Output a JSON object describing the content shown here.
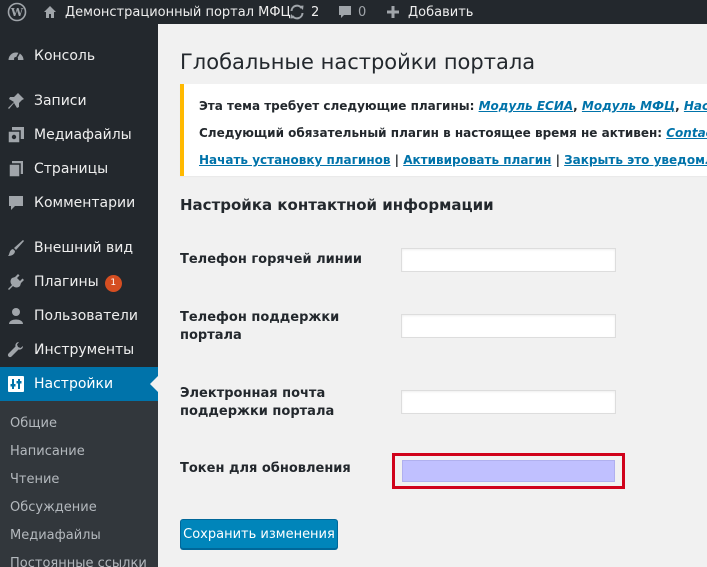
{
  "adminbar": {
    "site_title": "Демонстрационный портал МФЦ",
    "updates_count": "2",
    "comments_count": "0",
    "new_label": "Добавить"
  },
  "sidebar": {
    "items": [
      {
        "label": "Консоль",
        "icon": "dashboard-icon"
      },
      {
        "label": "Записи",
        "icon": "pin-icon"
      },
      {
        "label": "Медиафайлы",
        "icon": "media-icon"
      },
      {
        "label": "Страницы",
        "icon": "pages-icon"
      },
      {
        "label": "Комментарии",
        "icon": "comment-icon"
      },
      {
        "label": "Внешний вид",
        "icon": "brush-icon"
      },
      {
        "label": "Плагины",
        "icon": "plugin-icon",
        "badge": "1"
      },
      {
        "label": "Пользователи",
        "icon": "users-icon"
      },
      {
        "label": "Инструменты",
        "icon": "wrench-icon"
      },
      {
        "label": "Настройки",
        "icon": "settings-icon",
        "active": true
      }
    ],
    "submenu": [
      "Общие",
      "Написание",
      "Чтение",
      "Обсуждение",
      "Медиафайлы",
      "Постоянные ссылки"
    ]
  },
  "page": {
    "title": "Глобальные настройки портала"
  },
  "notice": {
    "line1_text": "Эта тема требует следующие плагины: ",
    "line1_links": [
      "Модуль ЕСИА",
      "Модуль МФЦ",
      "Настройка"
    ],
    "line1_sep": ", ",
    "line2_text": "Следующий обязательный плагин в настоящее время не активен: ",
    "line2_link": "Contact Form",
    "actions": [
      "Начать установку плагинов",
      "Активировать плагин",
      "Закрыть это уведомление"
    ],
    "actions_sep": " | "
  },
  "form": {
    "section_title": "Настройка контактной информации",
    "fields": [
      {
        "label": "Телефон горячей линии",
        "value": ""
      },
      {
        "label": "Телефон поддержки портала",
        "value": ""
      },
      {
        "label": "Электронная почта поддержки портала",
        "value": ""
      },
      {
        "label": "Токен для обновления",
        "value": ""
      }
    ],
    "save_label": "Сохранить изменения"
  }
}
